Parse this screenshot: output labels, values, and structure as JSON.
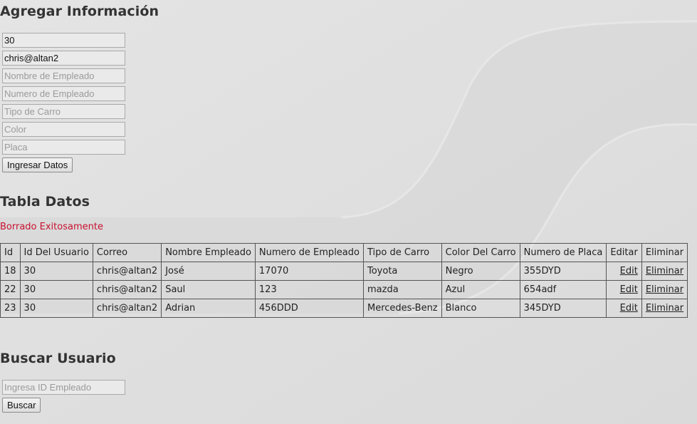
{
  "add_section": {
    "title": "Agregar Información",
    "fields": [
      {
        "name": "user-id-field",
        "value": "30",
        "placeholder": ""
      },
      {
        "name": "email-field",
        "value": "chris@altan2",
        "placeholder": ""
      },
      {
        "name": "employee-name-field",
        "value": "",
        "placeholder": "Nombre de Empleado"
      },
      {
        "name": "employee-number-field",
        "value": "",
        "placeholder": "Numero de Empleado"
      },
      {
        "name": "car-type-field",
        "value": "",
        "placeholder": "Tipo de Carro"
      },
      {
        "name": "color-field",
        "value": "",
        "placeholder": "Color"
      },
      {
        "name": "plate-field",
        "value": "",
        "placeholder": "Placa"
      }
    ],
    "submit_label": "Ingresar Datos"
  },
  "table_section": {
    "title": "Tabla Datos",
    "status_message": "Borrado Exitosamente",
    "status_color": "#c8102e",
    "headers": [
      "Id",
      "Id Del Usuario",
      "Correo",
      "Nombre Empleado",
      "Numero de Empleado",
      "Tipo de Carro",
      "Color Del Carro",
      "Numero de Placa",
      "Editar",
      "Eliminar"
    ],
    "rows": [
      {
        "id": "18",
        "user_id": "30",
        "email": "chris@altan2",
        "name": "José",
        "employee_number": "17070",
        "car_type": "Toyota",
        "car_color": "Negro",
        "plate": "355DYD",
        "edit": "Edit",
        "delete": "Eliminar"
      },
      {
        "id": "22",
        "user_id": "30",
        "email": "chris@altan2",
        "name": "Saul",
        "employee_number": "123",
        "car_type": "mazda",
        "car_color": "Azul",
        "plate": "654adf",
        "edit": "Edit",
        "delete": "Eliminar"
      },
      {
        "id": "23",
        "user_id": "30",
        "email": "chris@altan2",
        "name": "Adrian",
        "employee_number": "456DDD",
        "car_type": "Mercedes-Benz",
        "car_color": "Blanco",
        "plate": "345DYD",
        "edit": "Edit",
        "delete": "Eliminar"
      }
    ]
  },
  "search_section": {
    "title": "Buscar Usuario",
    "placeholder": "Ingresa ID Empleado",
    "value": "",
    "button_label": "Buscar"
  }
}
